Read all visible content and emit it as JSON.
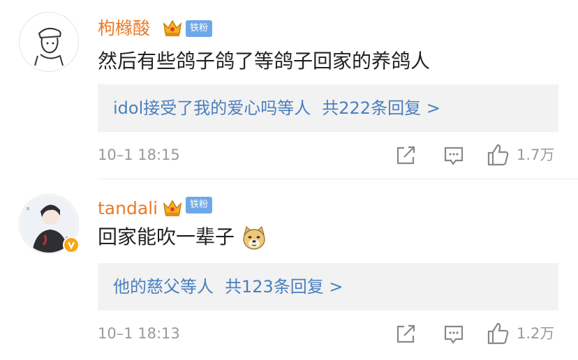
{
  "comments": [
    {
      "username": "枸橼酸",
      "fan_badge": "铁粉",
      "text": "然后有些鸽子鸽了等鸽子回家的养鸽人",
      "reply_summary": "idol接受了我的爱心吗等人",
      "reply_count": "共222条回复 >",
      "time": "10–1 18:15",
      "likes": "1.7万"
    },
    {
      "username": "tandali",
      "fan_badge": "铁粉",
      "text": "回家能吹一辈子",
      "text_emoji": "doge-emoji",
      "reply_summary": "他的慈父等人",
      "reply_count": "共123条回复 >",
      "time": "10–1 18:13",
      "likes": "1.2万"
    }
  ],
  "colors": {
    "username": "#ea7a27",
    "link": "#4a7fbe",
    "fan_badge": "#6fa8e8",
    "meta": "#999999",
    "reply_bg": "#f2f2f2"
  },
  "icons": [
    "forward-icon",
    "comment-icon",
    "like-icon",
    "crown-icon",
    "verified-badge-icon"
  ]
}
